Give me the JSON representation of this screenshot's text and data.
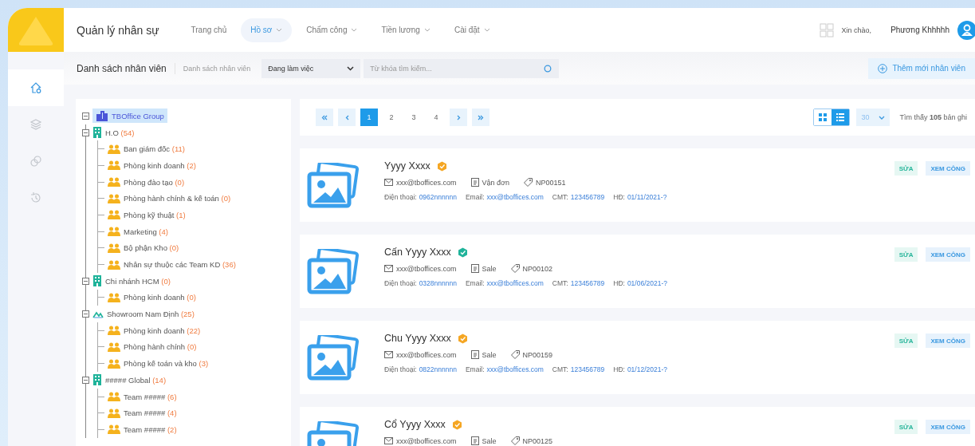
{
  "app": {
    "title": "Quản lý nhân sự"
  },
  "nav": [
    {
      "label": "Trang chủ",
      "selected": false,
      "dropdown": false
    },
    {
      "label": "Hồ sơ",
      "selected": true,
      "dropdown": true
    },
    {
      "label": "Chấm công",
      "selected": false,
      "dropdown": true
    },
    {
      "label": "Tiền lương",
      "selected": false,
      "dropdown": true
    },
    {
      "label": "Cài đặt",
      "selected": false,
      "dropdown": true
    }
  ],
  "user": {
    "greeting": "Xin chào,",
    "name": "Phương Khhhhh"
  },
  "sidebar": {
    "items": [
      {
        "kind": "home",
        "selected": true
      },
      {
        "kind": "layers",
        "selected": false
      },
      {
        "kind": "coins",
        "selected": false
      },
      {
        "kind": "history",
        "selected": false
      }
    ]
  },
  "toolbar": {
    "title": "Danh sách nhân viên",
    "breadcrumb": "Danh sách nhân viên",
    "status_filter": "Đang làm việc",
    "search": {
      "placeholder": "Từ khóa tìm kiếm..."
    },
    "add_button": "Thêm mới nhân viên"
  },
  "tree": {
    "label": "TBOffice Group",
    "kind": "company",
    "selected": true,
    "expanded": true,
    "children": [
      {
        "label": "H.O",
        "count": "(54)",
        "kind": "office",
        "expanded": true,
        "children": [
          {
            "label": "Ban giám đốc",
            "count": "(11)"
          },
          {
            "label": "Phòng kinh doanh",
            "count": "(2)"
          },
          {
            "label": "Phòng đào tạo",
            "count": "(0)"
          },
          {
            "label": "Phòng hành chính & kế toán",
            "count": "(0)"
          },
          {
            "label": "Phòng kỹ thuật",
            "count": "(1)"
          },
          {
            "label": "Marketing",
            "count": "(4)"
          },
          {
            "label": "Bộ phận Kho",
            "count": "(0)"
          },
          {
            "label": "Nhân sự thuộc các Team KD",
            "count": "(36)"
          }
        ]
      },
      {
        "label": "Chi nhánh HCM",
        "count": "(0)",
        "kind": "office",
        "expanded": true,
        "children": [
          {
            "label": "Phòng kinh doanh",
            "count": "(0)"
          }
        ]
      },
      {
        "label": "Showroom Nam Định",
        "count": "(25)",
        "kind": "showroom",
        "expanded": true,
        "children": [
          {
            "label": "Phòng kinh doanh",
            "count": "(22)"
          },
          {
            "label": "Phòng hành chính",
            "count": "(0)"
          },
          {
            "label": "Phòng kế toán và kho",
            "count": "(3)"
          }
        ]
      },
      {
        "label": "##### Global",
        "count": "(14)",
        "kind": "office",
        "expanded": true,
        "children": [
          {
            "label": "Team #####",
            "count": "(6)"
          },
          {
            "label": "Team #####",
            "count": "(4)"
          },
          {
            "label": "Team #####",
            "count": "(2)"
          }
        ]
      }
    ]
  },
  "pagination": {
    "pages": [
      {
        "label": "1",
        "selected": true
      },
      {
        "label": "2",
        "selected": false
      },
      {
        "label": "3",
        "selected": false
      },
      {
        "label": "4",
        "selected": false
      }
    ],
    "views": [
      {
        "kind": "grid",
        "selected": false
      },
      {
        "kind": "list",
        "selected": true
      }
    ],
    "page_size": "30",
    "found": "Tìm thấy **105** bản ghi"
  },
  "employees": [
    {
      "name": "Yyyy Xxxx",
      "color": "#f5a623",
      "email": "xxx@tboffices.com",
      "department": "Vận đơn",
      "code": "NP00151",
      "details": [
        {
          "label": "Điện thoại:",
          "value": "0962nnnnnn"
        },
        {
          "label": "Email:",
          "value": "xxx@tboffices.com"
        },
        {
          "label": "CMT:",
          "value": "123456789"
        },
        {
          "label": "HĐ:",
          "value": "01/11/2021-?"
        }
      ],
      "actions": {
        "edit": "SỬA",
        "timesheet": "XEM CÔNG"
      }
    },
    {
      "name": "Cấn Yyyy Xxxx",
      "color": "#1fb39a",
      "email": "xxx@tboffices.com",
      "department": "Sale",
      "code": "NP00102",
      "details": [
        {
          "label": "Điện thoại:",
          "value": "0328nnnnnn"
        },
        {
          "label": "Email:",
          "value": "xxx@tboffices.com"
        },
        {
          "label": "CMT:",
          "value": "123456789"
        },
        {
          "label": "HĐ:",
          "value": "01/06/2021-?"
        }
      ],
      "actions": {
        "edit": "SỬA",
        "timesheet": "XEM CÔNG"
      }
    },
    {
      "name": "Chu Yyyy Xxxx",
      "color": "#f5a623",
      "email": "xxx@tboffices.com",
      "department": "Sale",
      "code": "NP00159",
      "details": [
        {
          "label": "Điện thoại:",
          "value": "0822nnnnnn"
        },
        {
          "label": "Email:",
          "value": "xxx@tboffices.com"
        },
        {
          "label": "CMT:",
          "value": "123456789"
        },
        {
          "label": "HĐ:",
          "value": "01/12/2021-?"
        }
      ],
      "actions": {
        "edit": "SỬA",
        "timesheet": "XEM CÔNG"
      }
    },
    {
      "name": "Cổ Yyyy Xxxx",
      "color": "#f5a623",
      "email": "xxx@tboffices.com",
      "department": "Sale",
      "code": "NP00125",
      "actions": {
        "edit": "SỬA",
        "timesheet": "XEM CÔNG"
      }
    }
  ]
}
